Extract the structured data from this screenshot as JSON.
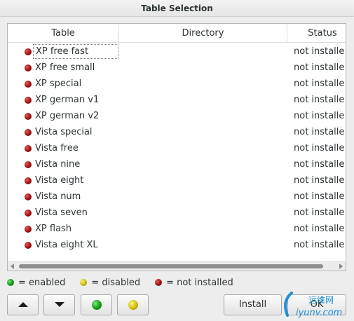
{
  "window": {
    "title": "Table Selection"
  },
  "table": {
    "columns": [
      "Table",
      "Directory",
      "Status"
    ],
    "rows": [
      {
        "name": "XP free fast",
        "directory": "",
        "status": "not installe"
      },
      {
        "name": "XP free small",
        "directory": "",
        "status": "not installe"
      },
      {
        "name": "XP special",
        "directory": "",
        "status": "not installe"
      },
      {
        "name": "XP german v1",
        "directory": "",
        "status": "not installe"
      },
      {
        "name": "XP german v2",
        "directory": "",
        "status": "not installe"
      },
      {
        "name": "Vista special",
        "directory": "",
        "status": "not installe"
      },
      {
        "name": "Vista free",
        "directory": "",
        "status": "not installe"
      },
      {
        "name": "Vista nine",
        "directory": "",
        "status": "not installe"
      },
      {
        "name": "Vista eight",
        "directory": "",
        "status": "not installe"
      },
      {
        "name": "Vista num",
        "directory": "",
        "status": "not installe"
      },
      {
        "name": "Vista seven",
        "directory": "",
        "status": "not installe"
      },
      {
        "name": "XP flash",
        "directory": "",
        "status": "not installe"
      },
      {
        "name": "Vista eight XL",
        "directory": "",
        "status": "not installe"
      }
    ]
  },
  "legend": {
    "enabled": "= enabled",
    "disabled": "= disabled",
    "not_installed": "= not installed"
  },
  "buttons": {
    "move_up_icon": "triangle-up-icon",
    "move_down_icon": "triangle-down-icon",
    "enable_icon": "green-dot-icon",
    "disable_icon": "yellow-dot-icon",
    "install": "Install",
    "ok": "OK"
  },
  "watermark": {
    "line1": "运维网",
    "line2": "iyunv.com"
  },
  "colors": {
    "enabled": "#149414",
    "disabled": "#c9b80c",
    "not_installed": "#a10f0f",
    "window_bg": "#ededed"
  }
}
